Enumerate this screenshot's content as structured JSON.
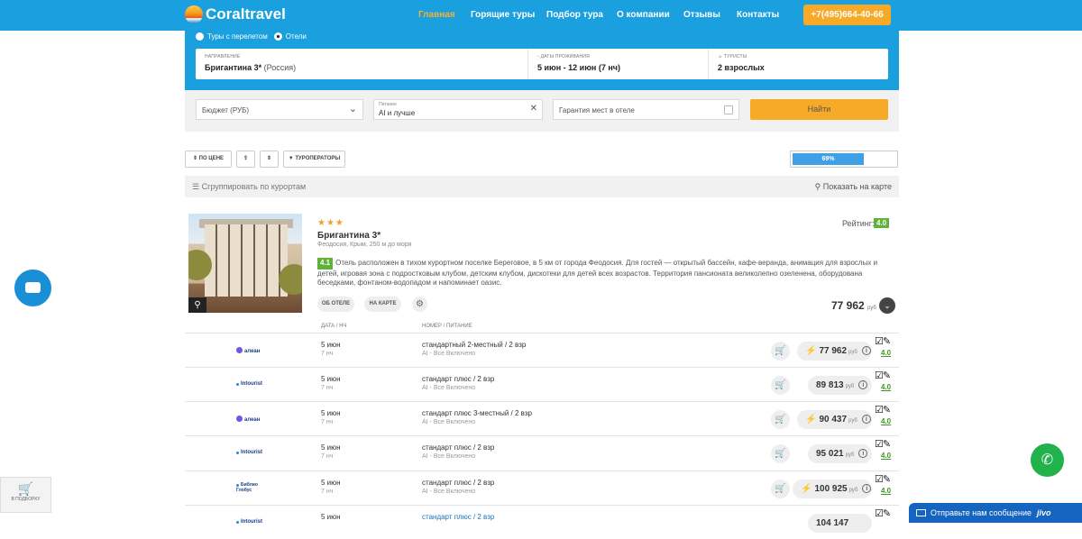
{
  "header": {
    "logo_text": "Coraltravel",
    "nav": [
      "Главная",
      "Горящие туры",
      "Подбор тура",
      "О компании",
      "Отзывы",
      "Контакты"
    ],
    "phone": "+7(495)664-40-66"
  },
  "search": {
    "radio_flight_label": "Туры с перелетом",
    "radio_hotels_label": "Отели",
    "direction_caption": "НАПРАВЛЕНИЕ",
    "direction_value": "Бригантина 3*",
    "direction_country": "(Россия)",
    "dates_caption": "ДАТЫ ПРОЖИВАНИЯ",
    "dates_value": "5 июн - 12 июн (7 нч)",
    "tourists_caption": "ТУРИСТЫ",
    "tourists_value": "2 взрослых"
  },
  "filters": {
    "budget": "Бюджет (РУБ)",
    "meal_caption": "Питание",
    "meal_value": "AI и лучше",
    "guarantee": "Гарантия мест в отеле",
    "find_button": "Найти"
  },
  "toolbar": {
    "sort_price": "ПО ЦЕНЕ",
    "operators": "ТУРОПЕРАТОРЫ",
    "progress_label": "69%",
    "progress_value": 0.69
  },
  "group_bar": {
    "group_label": "Сгруппировать по курортам",
    "map_label": "Показать на карте"
  },
  "hotel": {
    "stars": "★★★",
    "name": "Бригантина 3*",
    "location": "Феодосия, Крым, 250 м до моря",
    "rating_label": "Рейтинг:",
    "rating": "4.0",
    "desc_badge": "4.1",
    "description": "Отель расположен в тихом курортном поселке Береговое, в 5 км от города Феодосия. Для гостей — открытый бассейн, кафе-веранда, анимация для взрослых и детей, игровая зона с подростковым клубом, детским клубом, дискотеки для детей всех возрастов. Территория пансионата великолепно озеленена, оборудована беседками, фонтаном-водопадом и напоминает оазис.",
    "about_button": "ОБ ОТЕЛЕ",
    "map_button": "НА КАРТЕ",
    "price": "77 962",
    "currency": "руб"
  },
  "offers_header": {
    "date_col": "ДАТА / НЧ",
    "room_col": "НОМЕР / ПИТАНИЕ"
  },
  "offers": [
    {
      "operator": "алеан",
      "date": "5 июн",
      "nights": "7 нч",
      "room": "стандартный 2-местный / 2 взр",
      "meal": "AI - Все Включено",
      "price": "77 962",
      "hot": true,
      "rating": "4.0"
    },
    {
      "operator": "Intourist",
      "date": "5 июн",
      "nights": "7 нч",
      "room": "стандарт плюс / 2 взр",
      "meal": "AI - Все Включено",
      "price": "89 813",
      "hot": false,
      "rating": "4.0"
    },
    {
      "operator": "алеан",
      "date": "5 июн",
      "nights": "7 нч",
      "room": "стандарт плюс 3-местный / 2 взр",
      "meal": "AI - Все Включено",
      "price": "90 437",
      "hot": true,
      "rating": "4.0"
    },
    {
      "operator": "Intourist",
      "date": "5 июн",
      "nights": "7 нч",
      "room": "стандарт плюс / 2 взр",
      "meal": "AI - Все Включено",
      "price": "95 021",
      "hot": false,
      "rating": "4.0"
    },
    {
      "operator": "Библио Глобус",
      "date": "5 июн",
      "nights": "7 нч",
      "room": "стандарт плюс / 2 взр",
      "meal": "AI - Все Включено",
      "price": "100 925",
      "hot": true,
      "rating": "4.0"
    },
    {
      "operator": "Intourist",
      "date": "5 июн",
      "nights": "",
      "room": "стандарт плюс / 2 взр",
      "meal": "",
      "price": "104 147",
      "hot": false,
      "rating": ""
    }
  ],
  "widgets": {
    "cart_label": "В ПОДБОРКУ",
    "jivo_text": "Отправьте нам сообщение",
    "jivo_brand": "jivo"
  },
  "colors": {
    "primary": "#1aa0de",
    "accent": "#f7a928",
    "rating": "#5fb33b"
  }
}
